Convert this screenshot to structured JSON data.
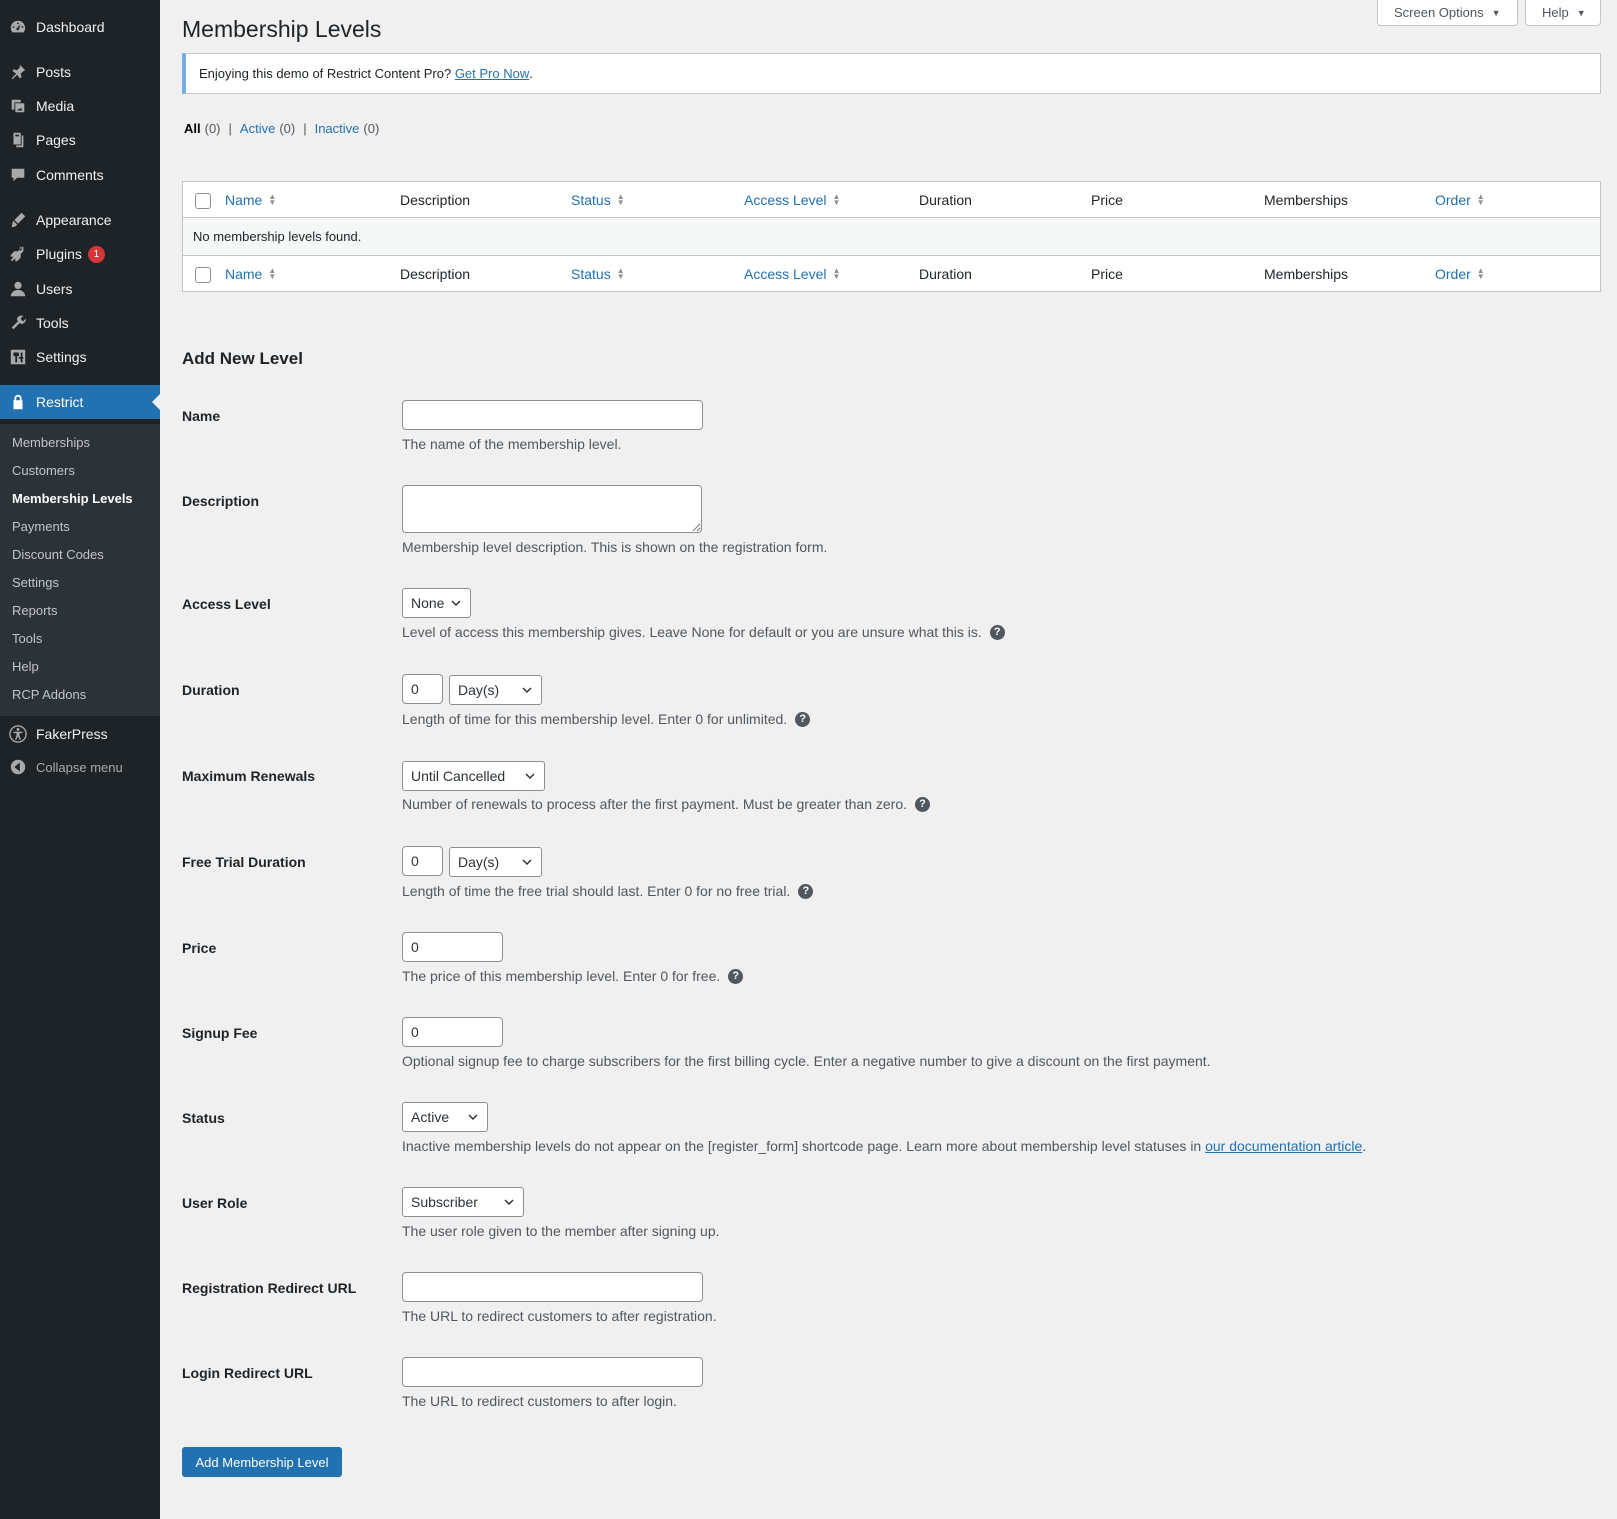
{
  "sidebar": {
    "items": [
      {
        "label": "Dashboard",
        "icon": "dashboard-icon"
      },
      {
        "label": "Posts",
        "icon": "pin-icon"
      },
      {
        "label": "Media",
        "icon": "media-icon"
      },
      {
        "label": "Pages",
        "icon": "pages-icon"
      },
      {
        "label": "Comments",
        "icon": "comment-icon"
      },
      {
        "label": "Appearance",
        "icon": "brush-icon"
      },
      {
        "label": "Plugins",
        "icon": "plugin-icon",
        "badge": "1"
      },
      {
        "label": "Users",
        "icon": "user-icon"
      },
      {
        "label": "Tools",
        "icon": "wrench-icon"
      },
      {
        "label": "Settings",
        "icon": "settings-icon"
      },
      {
        "label": "Restrict",
        "icon": "lock-icon"
      },
      {
        "label": "FakerPress",
        "icon": "accessibility-icon"
      },
      {
        "label": "Collapse menu",
        "icon": "collapse-icon"
      }
    ],
    "submenu": [
      "Memberships",
      "Customers",
      "Membership Levels",
      "Payments",
      "Discount Codes",
      "Settings",
      "Reports",
      "Tools",
      "Help",
      "RCP Addons"
    ]
  },
  "header": {
    "title": "Membership Levels",
    "screen_options": "Screen Options",
    "help": "Help"
  },
  "notice": {
    "text": "Enjoying this demo of Restrict Content Pro?",
    "link": "Get Pro Now",
    "suffix": "."
  },
  "filters": {
    "all": "All",
    "all_count": "(0)",
    "active": "Active",
    "active_count": "(0)",
    "inactive": "Inactive",
    "inactive_count": "(0)",
    "separator": "|"
  },
  "table": {
    "columns": [
      "Name",
      "Description",
      "Status",
      "Access Level",
      "Duration",
      "Price",
      "Memberships",
      "Order"
    ],
    "empty": "No membership levels found."
  },
  "form": {
    "title": "Add New Level",
    "name": {
      "label": "Name",
      "value": "",
      "desc": "The name of the membership level."
    },
    "description": {
      "label": "Description",
      "value": "",
      "desc": "Membership level description. This is shown on the registration form."
    },
    "access_level": {
      "label": "Access Level",
      "value": "None",
      "desc": "Level of access this membership gives. Leave None for default or you are unsure what this is."
    },
    "duration": {
      "label": "Duration",
      "value": "0",
      "unit": "Day(s)",
      "desc": "Length of time for this membership level. Enter 0 for unlimited."
    },
    "max_renewals": {
      "label": "Maximum Renewals",
      "value": "Until Cancelled",
      "desc": "Number of renewals to process after the first payment. Must be greater than zero."
    },
    "trial": {
      "label": "Free Trial Duration",
      "value": "0",
      "unit": "Day(s)",
      "desc": "Length of time the free trial should last. Enter 0 for no free trial."
    },
    "price": {
      "label": "Price",
      "value": "0",
      "desc": "The price of this membership level. Enter 0 for free."
    },
    "signup_fee": {
      "label": "Signup Fee",
      "value": "0",
      "desc": "Optional signup fee to charge subscribers for the first billing cycle. Enter a negative number to give a discount on the first payment."
    },
    "status": {
      "label": "Status",
      "value": "Active",
      "desc": "Inactive membership levels do not appear on the [register_form] shortcode page. Learn more about membership level statuses in",
      "link": "our documentation article",
      "suffix": "."
    },
    "user_role": {
      "label": "User Role",
      "value": "Subscriber",
      "desc": "The user role given to the member after signing up."
    },
    "reg_redirect": {
      "label": "Registration Redirect URL",
      "value": "",
      "desc": "The URL to redirect customers to after registration."
    },
    "login_redirect": {
      "label": "Login Redirect URL",
      "value": "",
      "desc": "The URL to redirect customers to after login."
    },
    "submit": "Add Membership Level"
  },
  "colors": {
    "sidebar_bg": "#1d2327",
    "submenu_bg": "#2c3338",
    "accent": "#2271b1",
    "badge": "#d63638",
    "notice_border": "#72aee6"
  }
}
